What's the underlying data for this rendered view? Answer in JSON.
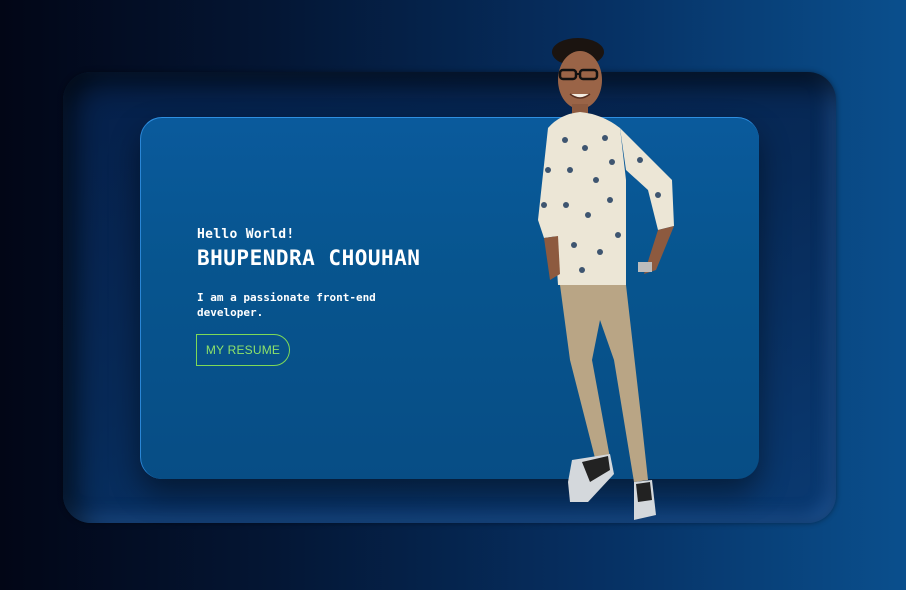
{
  "hero": {
    "greeting": "Hello World!",
    "name": "BHUPENDRA CHOUHAN",
    "tagline": "I am a passionate front-end developer.",
    "resume_button_label": "MY RESUME"
  },
  "colors": {
    "accent": "#7ed957",
    "card": "#07558f",
    "background": "#041634"
  }
}
